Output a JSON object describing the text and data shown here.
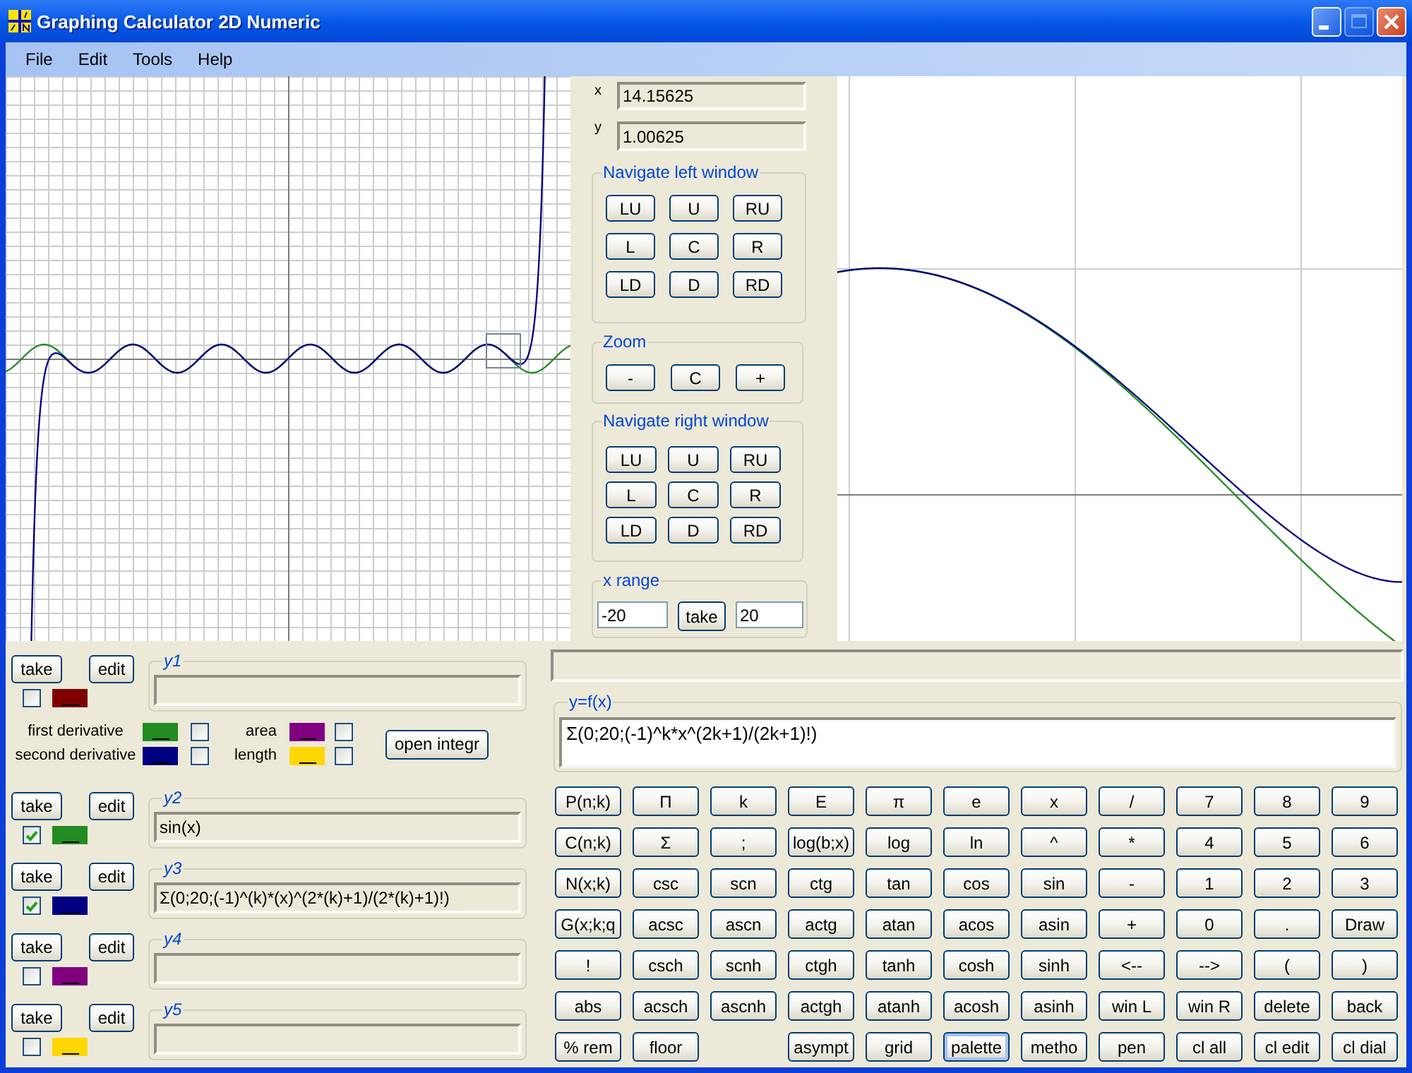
{
  "window": {
    "title": "Graphing Calculator 2D Numeric",
    "controls": [
      {
        "kind": "minimize",
        "disabled": false
      },
      {
        "kind": "maximize",
        "disabled": true
      },
      {
        "kind": "close",
        "disabled": false
      }
    ]
  },
  "menu": [
    "File",
    "Edit",
    "Tools",
    "Help"
  ],
  "cursor": {
    "x_label": "x",
    "x_value": "14.15625",
    "y_label": "y",
    "y_value": "1.00625"
  },
  "navigate_left": {
    "title": "Navigate left window",
    "buttons": [
      "LU",
      "U",
      "RU",
      "L",
      "C",
      "R",
      "LD",
      "D",
      "RD"
    ]
  },
  "zoom": {
    "title": "Zoom",
    "buttons": [
      "-",
      "C",
      "+"
    ]
  },
  "navigate_right": {
    "title": "Navigate right window",
    "buttons": [
      "LU",
      "U",
      "RU",
      "L",
      "C",
      "R",
      "LD",
      "D",
      "RD"
    ]
  },
  "x_range": {
    "title": "x range",
    "from": "-20",
    "button": "take",
    "to": "20"
  },
  "functions": [
    {
      "name": "y1",
      "take": "take",
      "edit": "edit",
      "checked": false,
      "color": "#800000"
    },
    {
      "name": "y2",
      "take": "take",
      "edit": "edit",
      "checked": true,
      "color": "#228b22",
      "value": "sin(x)"
    },
    {
      "name": "y3",
      "take": "take",
      "edit": "edit",
      "checked": true,
      "color": "#000080",
      "value": "Σ(0;20;(-1)^(k)*(x)^(2*(k)+1)/(2*(k)+1)!)"
    },
    {
      "name": "y4",
      "take": "take",
      "edit": "edit",
      "checked": false,
      "color": "#800080"
    },
    {
      "name": "y5",
      "take": "take",
      "edit": "edit",
      "checked": false,
      "color": "#ffd700"
    }
  ],
  "derivatives": [
    {
      "label": "first derivative",
      "color": "#228b22",
      "checked": false
    },
    {
      "label": "second derivative",
      "color": "#000080",
      "checked": false
    }
  ],
  "measures": [
    {
      "label": "area",
      "color": "#800080",
      "checked": false
    },
    {
      "label": "length",
      "color": "#ffd700",
      "checked": false
    }
  ],
  "open_integral": "open integr",
  "expression": {
    "title": "y=f(x)",
    "value": "Σ(0;20;(-1)^k*x^(2k+1)/(2k+1)!)"
  },
  "keypad": {
    "left_keys": [
      [
        {
          "label": "P(n;k)",
          "focused": false
        },
        {
          "label": "Π",
          "focused": false
        },
        {
          "label": "k",
          "focused": false
        }
      ],
      [
        {
          "label": "C(n;k)",
          "focused": false
        },
        {
          "label": "Σ",
          "focused": false
        },
        {
          "label": ";",
          "focused": false
        }
      ],
      [
        {
          "label": "N(x;k)",
          "focused": false
        },
        {
          "label": "csc",
          "focused": false
        },
        {
          "label": "scn",
          "focused": false
        }
      ],
      [
        {
          "label": "G(x;k;q",
          "focused": false
        },
        {
          "label": "acsc",
          "focused": false
        },
        {
          "label": "ascn",
          "focused": false
        }
      ],
      [
        {
          "label": "!",
          "focused": false
        },
        {
          "label": "csch",
          "focused": false
        },
        {
          "label": "scnh",
          "focused": false
        }
      ],
      [
        {
          "label": "abs",
          "focused": false
        },
        {
          "label": "acsch",
          "focused": false
        },
        {
          "label": "ascnh",
          "focused": false
        }
      ],
      [
        {
          "label": "% rem",
          "focused": false
        },
        {
          "label": "floor",
          "focused": false
        }
      ]
    ],
    "right_keys": [
      [
        {
          "label": "E",
          "focused": false
        },
        {
          "label": "π",
          "focused": false
        },
        {
          "label": "e",
          "focused": false
        },
        {
          "label": "x",
          "focused": false
        },
        {
          "label": "/",
          "focused": false
        },
        {
          "label": "7",
          "focused": false
        },
        {
          "label": "8",
          "focused": false
        },
        {
          "label": "9",
          "focused": false
        }
      ],
      [
        {
          "label": "log(b;x)",
          "focused": false
        },
        {
          "label": "log",
          "focused": false
        },
        {
          "label": "ln",
          "focused": false
        },
        {
          "label": "^",
          "focused": false
        },
        {
          "label": "*",
          "focused": false
        },
        {
          "label": "4",
          "focused": false
        },
        {
          "label": "5",
          "focused": false
        },
        {
          "label": "6",
          "focused": false
        }
      ],
      [
        {
          "label": "ctg",
          "focused": false
        },
        {
          "label": "tan",
          "focused": false
        },
        {
          "label": "cos",
          "focused": false
        },
        {
          "label": "sin",
          "focused": false
        },
        {
          "label": "-",
          "focused": false
        },
        {
          "label": "1",
          "focused": false
        },
        {
          "label": "2",
          "focused": false
        },
        {
          "label": "3",
          "focused": false
        }
      ],
      [
        {
          "label": "actg",
          "focused": false
        },
        {
          "label": "atan",
          "focused": false
        },
        {
          "label": "acos",
          "focused": false
        },
        {
          "label": "asin",
          "focused": false
        },
        {
          "label": "+",
          "focused": false
        },
        {
          "label": "0",
          "focused": false
        },
        {
          "label": ".",
          "focused": false
        },
        {
          "label": "Draw",
          "focused": false
        }
      ],
      [
        {
          "label": "ctgh",
          "focused": false
        },
        {
          "label": "tanh",
          "focused": false
        },
        {
          "label": "cosh",
          "focused": false
        },
        {
          "label": "sinh",
          "focused": false
        },
        {
          "label": "<--",
          "focused": false
        },
        {
          "label": "-->",
          "focused": false
        },
        {
          "label": "(",
          "focused": false
        },
        {
          "label": ")",
          "focused": false
        }
      ],
      [
        {
          "label": "actgh",
          "focused": false
        },
        {
          "label": "atanh",
          "focused": false
        },
        {
          "label": "acosh",
          "focused": false
        },
        {
          "label": "asinh",
          "focused": false
        },
        {
          "label": "win L",
          "focused": false
        },
        {
          "label": "win R",
          "focused": false
        },
        {
          "label": "delete",
          "focused": false
        },
        {
          "label": "back",
          "focused": false
        }
      ],
      [
        {
          "label": "asympt",
          "focused": false
        },
        {
          "label": "grid",
          "focused": false
        },
        {
          "label": "palette",
          "focused": true
        },
        {
          "label": "metho",
          "focused": false
        },
        {
          "label": "pen",
          "focused": false
        },
        {
          "label": "cl all",
          "focused": false
        },
        {
          "label": "cl edit",
          "focused": false
        },
        {
          "label": "cl dial",
          "focused": false
        }
      ]
    ]
  }
}
